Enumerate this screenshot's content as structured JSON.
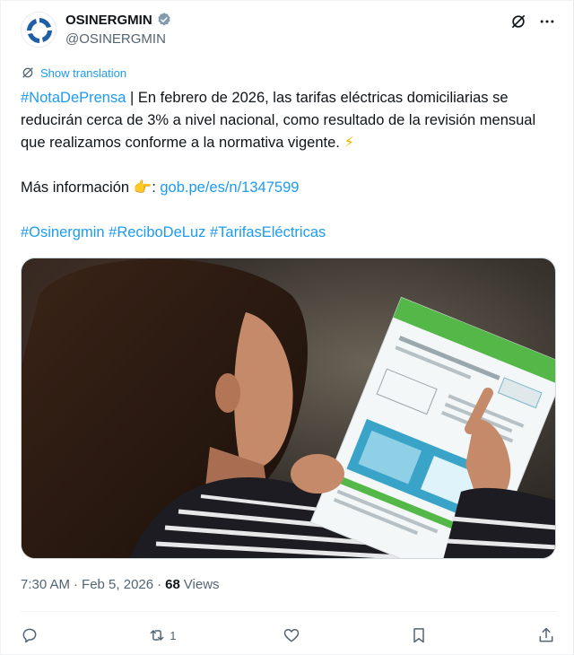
{
  "author": {
    "display_name": "OSINERGMIN",
    "handle": "@OSINERGMIN",
    "avatar_icon": "osinergmin-logo",
    "verified_icon": "verified-badge-icon"
  },
  "header_actions": [
    "grok-icon",
    "more-icon"
  ],
  "translate_label": "Show translation",
  "text": {
    "hashtag_press": "#NotaDePrensa",
    "line1_rest": " | En febrero de 2026, las tarifas eléctricas domiciliarias se reducirán cerca de 3% a nivel nacional, como resultado de la revisión mensual que realizamos conforme a la normativa vigente. ",
    "bolt": "⚡",
    "more_info": "Más información ",
    "pointer": "👉",
    "colon": ": ",
    "link": "gob.pe/es/n/1347599",
    "hashtag1": "#Osinergmin",
    "hashtag2": "#ReciboDeLuz",
    "hashtag3": "#TarifasEléctricas"
  },
  "meta": {
    "time": "7:30 AM",
    "separator": "·",
    "date": "Feb 5, 2026",
    "views_count": "68",
    "views_label": "Views"
  },
  "actions": {
    "reply_count": "",
    "repost_count": "1",
    "like_count": "",
    "bookmark_count": ""
  },
  "colors": {
    "accent": "#1d9bf0",
    "text": "#0f1419",
    "muted": "#536471"
  }
}
